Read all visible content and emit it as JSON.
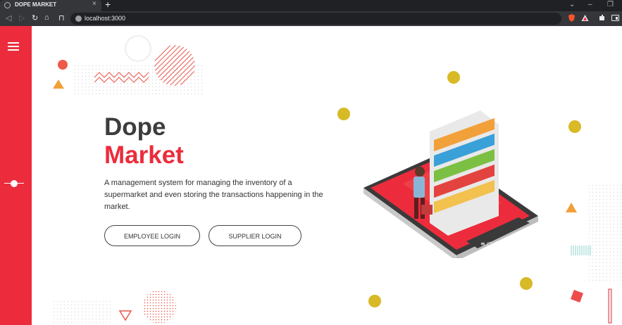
{
  "browser": {
    "tab_title": "DOPE MARKET",
    "tab_close": "×",
    "new_tab": "+",
    "url": "localhost:3000"
  },
  "hero": {
    "title_line1": "Dope",
    "title_line2": "Market",
    "description": "A management system for managing the inventory of a supermarket and even storing the transactions happening in the market."
  },
  "buttons": {
    "employee_login": "EMPLOYEE LOGIN",
    "supplier_login": "SUPPLIER LOGIN"
  },
  "colors": {
    "brand_red": "#ec2c3c",
    "accent_yellow": "#d8b926",
    "accent_orange": "#f2a03a",
    "text_dark": "#3c3c3c"
  },
  "icons": [
    "menu-icon",
    "slider-indicator-icon",
    "back-icon",
    "forward-icon",
    "reload-icon",
    "home-icon",
    "bookmark-icon",
    "info-icon",
    "brave-shield-icon",
    "extensions-icon",
    "sidebar-toggle-icon"
  ]
}
